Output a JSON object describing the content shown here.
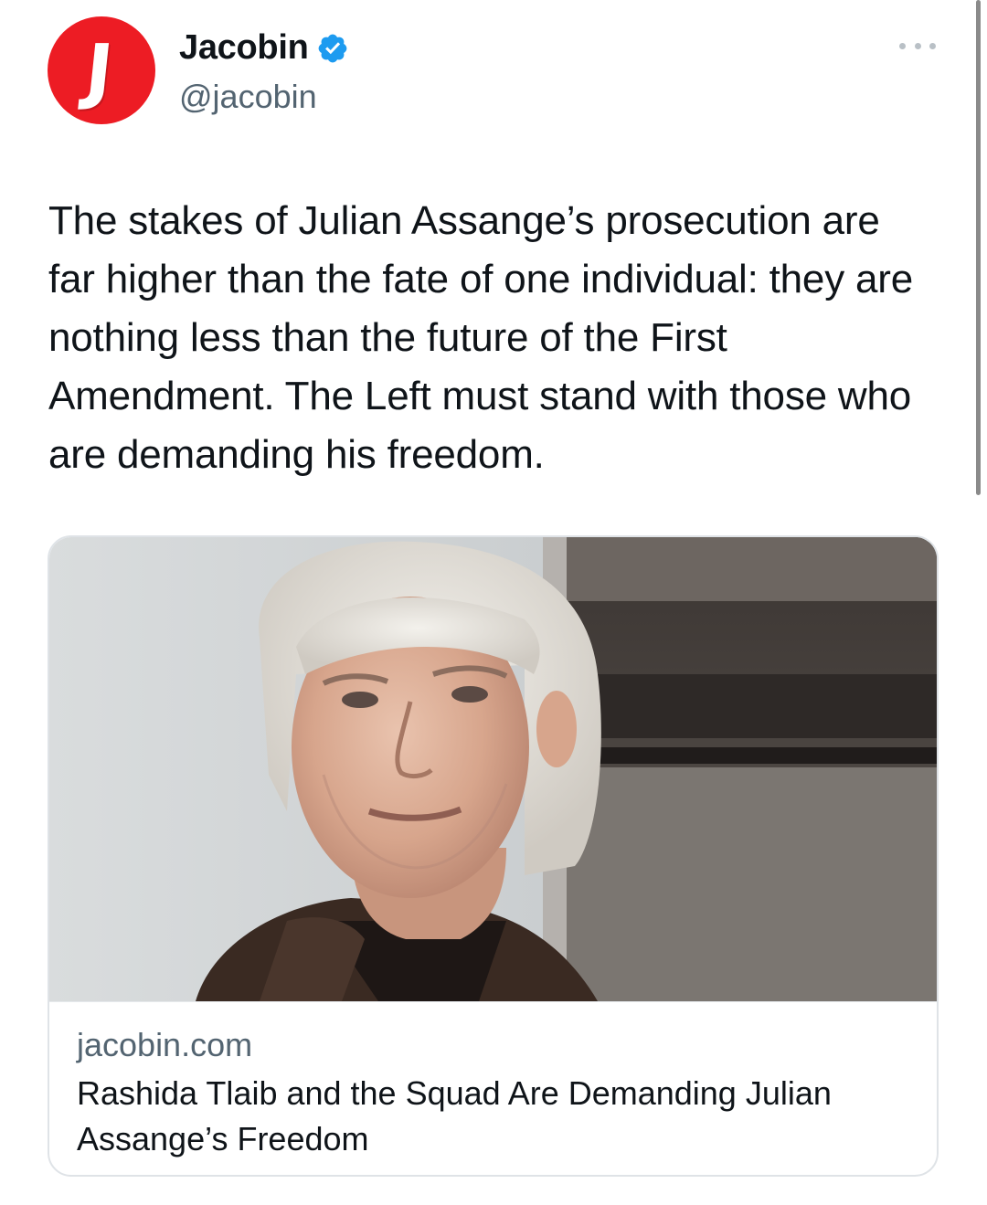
{
  "author": {
    "display_name": "Jacobin",
    "handle": "@jacobin",
    "avatar_letter": "J",
    "avatar_color": "#ed1c24",
    "verified": true,
    "verified_color": "#1d9bf0"
  },
  "menu": {
    "icon": "more-horizontal-icon"
  },
  "tweet": {
    "text": "The stakes of Julian Assange’s prosecution are far higher than the fate of one individual: they are nothing less than the future of the First Amendment. The Left must stand with those who are demanding his freedom."
  },
  "link_card": {
    "domain": "jacobin.com",
    "title": "Rashida Tlaib and the Squad Are Demanding Julian Assange’s Freedom"
  },
  "colors": {
    "text_primary": "#0f1419",
    "text_secondary": "#536471",
    "card_border": "#dfe3e7"
  }
}
